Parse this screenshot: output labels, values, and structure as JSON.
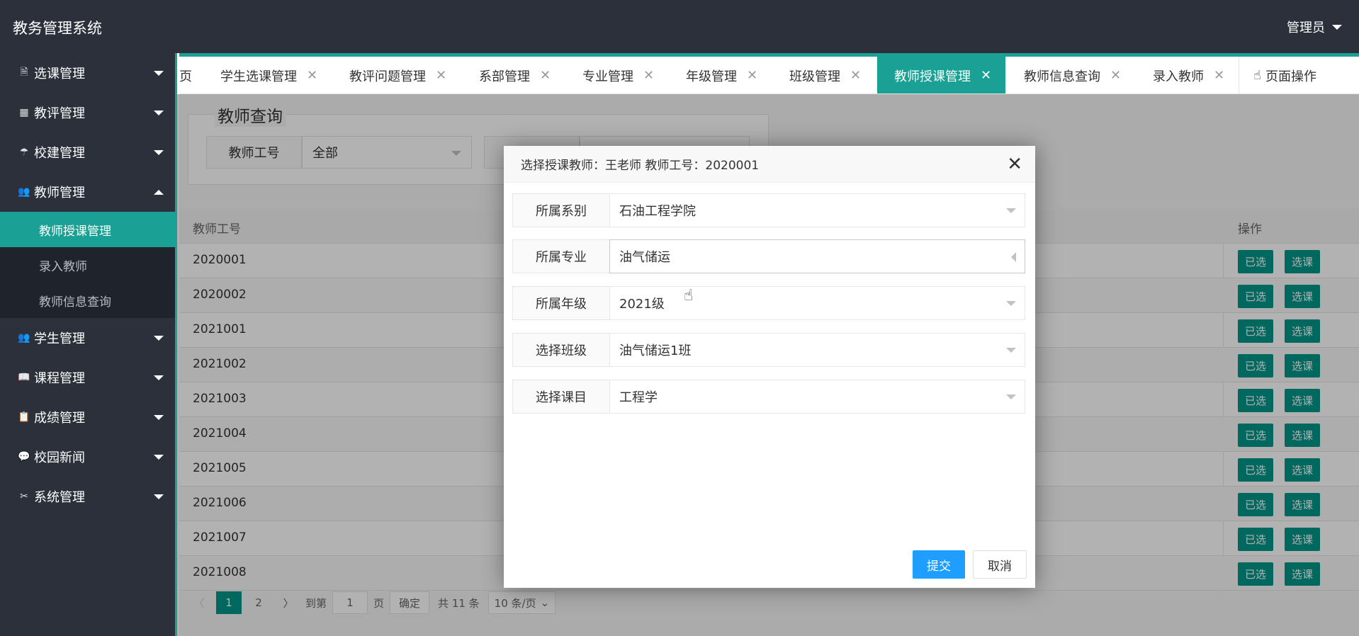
{
  "app": {
    "title": "教务管理系统",
    "user": "管理员"
  },
  "sidebar": {
    "items": [
      {
        "label": "选课管理",
        "icon": "document-icon"
      },
      {
        "label": "教评管理",
        "icon": "grid-icon"
      },
      {
        "label": "校建管理",
        "icon": "umbrella-icon"
      },
      {
        "label": "教师管理",
        "icon": "users-icon"
      },
      {
        "label": "学生管理",
        "icon": "users-icon"
      },
      {
        "label": "课程管理",
        "icon": "book-icon"
      },
      {
        "label": "成绩管理",
        "icon": "clipboard-icon"
      },
      {
        "label": "校园新闻",
        "icon": "chat-icon"
      },
      {
        "label": "系统管理",
        "icon": "tools-icon"
      }
    ],
    "teacher_sub": [
      "教师授课管理",
      "录入教师",
      "教师信息查询"
    ]
  },
  "tabs": [
    {
      "label": "页"
    },
    {
      "label": "学生选课管理"
    },
    {
      "label": "教评问题管理"
    },
    {
      "label": "系部管理"
    },
    {
      "label": "专业管理"
    },
    {
      "label": "年级管理"
    },
    {
      "label": "班级管理"
    },
    {
      "label": "教师授课管理",
      "active": true
    },
    {
      "label": "教师信息查询"
    },
    {
      "label": "录入教师"
    }
  ],
  "page_ops": "页面操作",
  "search": {
    "legend": "教师查询",
    "label": "教师工号",
    "value": "全部"
  },
  "table": {
    "headers": {
      "id": "教师工号",
      "op": "操作"
    },
    "rows": [
      "2020001",
      "2020002",
      "2021001",
      "2021002",
      "2021003",
      "2021004",
      "2021005",
      "2021006",
      "2021007",
      "2021008"
    ],
    "btn_selected": "已选",
    "btn_choose": "选课"
  },
  "pager": {
    "current": "1",
    "page2": "2",
    "goto": "到第",
    "goto_value": "1",
    "page_unit": "页",
    "confirm": "确定",
    "total": "共 11 条",
    "per_page": "10 条/页"
  },
  "modal": {
    "title": "选择授课教师：王老师 教师工号：2020001",
    "fields": [
      {
        "label": "所属系别",
        "value": "石油工程学院"
      },
      {
        "label": "所属专业",
        "value": "油气储运"
      },
      {
        "label": "所属年级",
        "value": "2021级"
      },
      {
        "label": "选择班级",
        "value": "油气储运1班"
      },
      {
        "label": "选择课目",
        "value": "工程学"
      }
    ],
    "submit": "提交",
    "cancel": "取消"
  },
  "colors": {
    "accent": "#1aa094",
    "primary_btn": "#1e9fff",
    "dark": "#2b303b"
  }
}
